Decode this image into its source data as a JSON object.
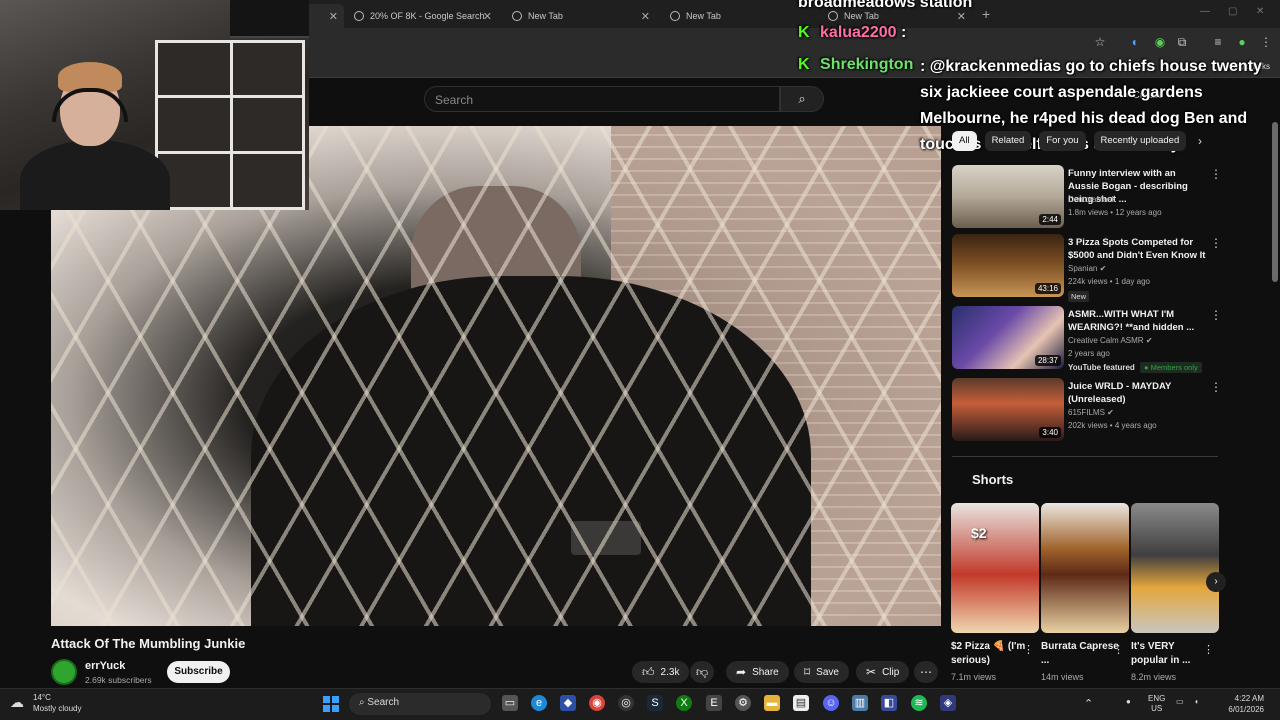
{
  "browser": {
    "tabs": [
      {
        "label": "20% OF 8K - Google Search"
      },
      {
        "label": "New Tab"
      },
      {
        "label": "New Tab"
      },
      {
        "label": "New Tab"
      }
    ],
    "bookmarks_label": "Bookmarks"
  },
  "youtube": {
    "search_placeholder": "Search",
    "create_label": "Create"
  },
  "chat": {
    "top_line": "broadmeadows station",
    "messages": [
      {
        "user": "kalua2200",
        "text": ":"
      },
      {
        "user": "Shrekington",
        "text": ": @krackenmedias go to chiefs house twenty six jackieee court aspendale gardens Melbourne, he r4ped his dead dog Ben and touches himself to his sister Lizzy."
      }
    ]
  },
  "video": {
    "title": "Attack Of The Mumbling Junkie",
    "channel": "errYuck",
    "subscribers": "2.69k subscribers",
    "subscribe_label": "Subscribe",
    "likes": "2.3k",
    "share_label": "Share",
    "save_label": "Save",
    "clip_label": "Clip"
  },
  "chips": [
    "All",
    "Related",
    "For you",
    "Recently uploaded"
  ],
  "recommendations": [
    {
      "title": "Funny interview with an Aussie Bogan - describing being shot ...",
      "channel": "CantoraMask",
      "meta": "1.8m views • 12 years ago",
      "duration": "2:44"
    },
    {
      "title": "3 Pizza Spots Competed for $5000 and Didn't Even Know It",
      "channel": "Spanian",
      "meta": "224k views • 1 day ago",
      "duration": "43:16",
      "badge": "New"
    },
    {
      "title": "ASMR...WITH WHAT I'M WEARING?! **and hidden ...",
      "channel": "Creative Calm ASMR",
      "meta": "2 years ago",
      "duration": "28:37",
      "featured": "YouTube featured",
      "members": "Members only"
    },
    {
      "title": "Juice WRLD - MAYDAY (Unreleased)",
      "channel": "615FILMS",
      "meta": "202k views • 4 years ago",
      "duration": "3:40"
    }
  ],
  "shorts": {
    "heading": "Shorts",
    "items": [
      {
        "title": "$2 Pizza 🍕 (I'm serious)",
        "views": "7.1m views",
        "overlay": "$2"
      },
      {
        "title": "Burrata Caprese ...",
        "views": "14m views"
      },
      {
        "title": "It's VERY popular in ...",
        "views": "8.2m views"
      }
    ]
  },
  "taskbar": {
    "temp": "14°C",
    "weather": "Mostly cloudy",
    "search_label": "Search",
    "lang": "ENG",
    "region": "US",
    "time": "4:22 AM",
    "date": "6/01/2026"
  }
}
